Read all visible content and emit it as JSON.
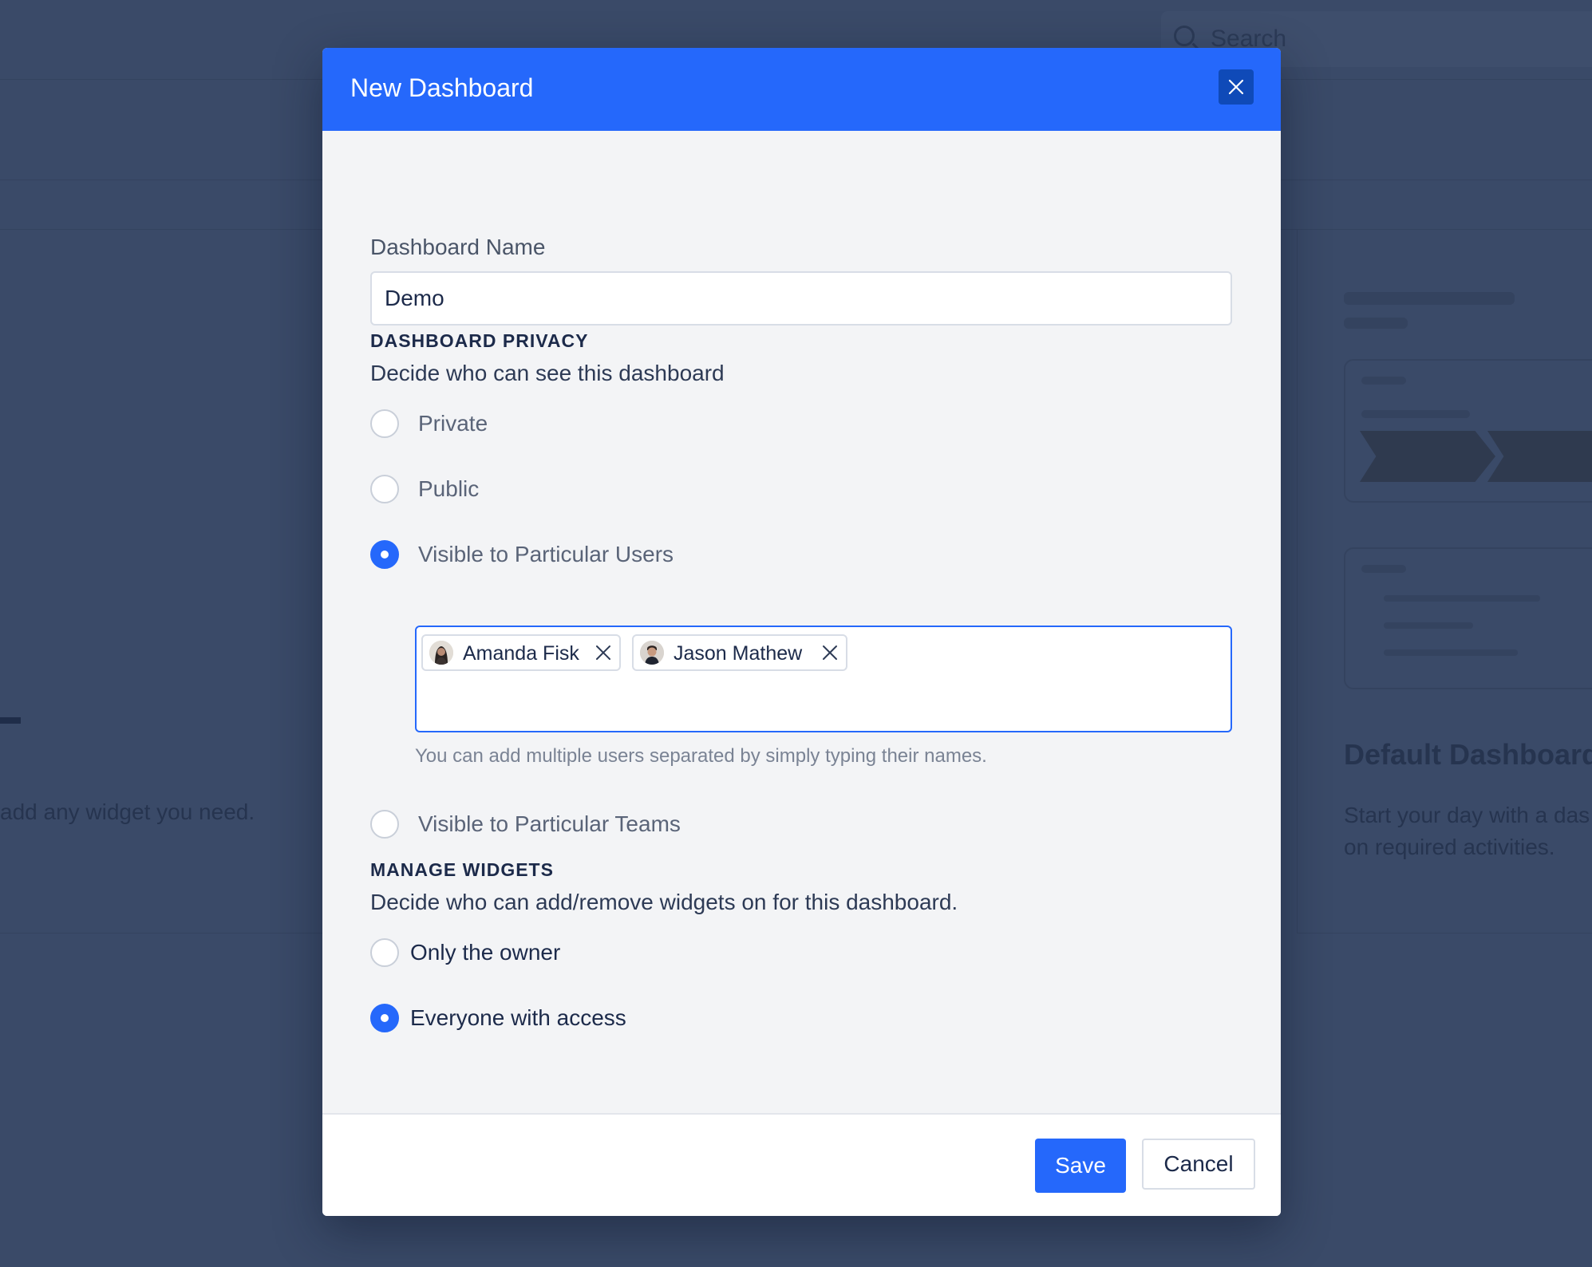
{
  "background": {
    "search_placeholder": "Search",
    "left_card_text": "add any widget you need.",
    "right_card_title": "Default Dashboard",
    "right_card_desc_line1": "Start your day with a das",
    "right_card_desc_line2": "on required activities."
  },
  "modal": {
    "title": "New Dashboard",
    "close_icon": "close-icon",
    "name_label": "Dashboard Name",
    "name_value": "Demo",
    "privacy": {
      "title": "DASHBOARD PRIVACY",
      "description": "Decide who can see this dashboard",
      "options": [
        {
          "label": "Private",
          "selected": false
        },
        {
          "label": "Public",
          "selected": false
        },
        {
          "label": "Visible to Particular Users",
          "selected": true
        },
        {
          "label": "Visible to Particular Teams",
          "selected": false
        }
      ],
      "selected_users": [
        {
          "name": "Amanda Fisk"
        },
        {
          "name": "Jason Mathew"
        }
      ],
      "users_hint": "You can add multiple users separated by simply typing their names."
    },
    "widgets": {
      "title": "MANAGE WIDGETS",
      "description": "Decide who can add/remove widgets on for this dashboard.",
      "options": [
        {
          "label": "Only the owner",
          "selected": false
        },
        {
          "label": "Everyone with access",
          "selected": true
        }
      ]
    },
    "footer": {
      "save_label": "Save",
      "cancel_label": "Cancel"
    }
  },
  "colors": {
    "accent": "#2568fb",
    "overlay": "#3a4a68",
    "modal_bg": "#f3f4f6"
  }
}
